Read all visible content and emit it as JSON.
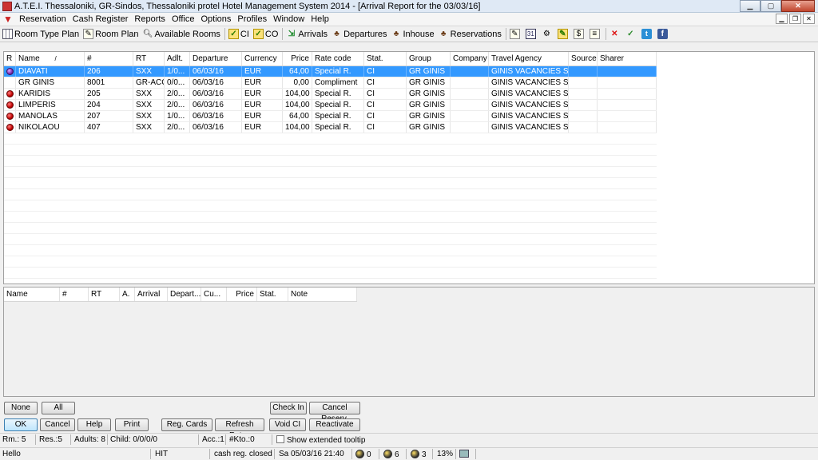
{
  "window": {
    "title": "A.T.E.I. Thessaloniki, GR-Sindos, Thessaloniki        protel Hotel Management System 2014 - [Arrival Report for the 03/03/16]"
  },
  "menu": [
    "Reservation",
    "Cash Register",
    "Reports",
    "Office",
    "Options",
    "Profiles",
    "Window",
    "Help"
  ],
  "toolbar": {
    "room_type_plan": "Room Type Plan",
    "room_plan": "Room Plan",
    "available_rooms": "Available Rooms",
    "ci": "CI",
    "co": "CO",
    "arrivals": "Arrivals",
    "departures": "Departures",
    "inhouse": "Inhouse",
    "reservations": "Reservations",
    "calendar_day": "31"
  },
  "top_grid": {
    "headers": [
      "R",
      "Name",
      "/",
      "#",
      "RT",
      "Adlt.",
      "Departure",
      "Currency",
      "Price",
      "Rate code",
      "Stat.",
      "Group",
      "Company",
      "Travel Agency",
      "Source",
      "Sharer"
    ],
    "rows": [
      {
        "status": "purple",
        "name": "DIAVATI",
        "num": "206",
        "rt": "SXX",
        "adlt": "1/0...",
        "departure": "06/03/16",
        "currency": "EUR",
        "price": "64,00",
        "rate_code": "Special R.",
        "stat": "CI",
        "group": "GR GINIS",
        "company": "",
        "agency": "GINIS VACANCIES SA",
        "source": "",
        "sharer": "",
        "selected": true
      },
      {
        "status": "none",
        "name": "GR GINIS",
        "num": "8001",
        "rt": "GR-ACC",
        "adlt": "0/0...",
        "departure": "06/03/16",
        "currency": "EUR",
        "price": "0,00",
        "rate_code": "Compliment",
        "stat": "CI",
        "group": "GR GINIS",
        "company": "",
        "agency": "GINIS VACANCIES SA",
        "source": "",
        "sharer": "",
        "selected": false
      },
      {
        "status": "red",
        "name": "KARIDIS",
        "num": "205",
        "rt": "SXX",
        "adlt": "2/0...",
        "departure": "06/03/16",
        "currency": "EUR",
        "price": "104,00",
        "rate_code": "Special R.",
        "stat": "CI",
        "group": "GR GINIS",
        "company": "",
        "agency": "GINIS VACANCIES SA",
        "source": "",
        "sharer": "",
        "selected": false
      },
      {
        "status": "red",
        "name": "LIMPERIS",
        "num": "204",
        "rt": "SXX",
        "adlt": "2/0...",
        "departure": "06/03/16",
        "currency": "EUR",
        "price": "104,00",
        "rate_code": "Special R.",
        "stat": "CI",
        "group": "GR GINIS",
        "company": "",
        "agency": "GINIS VACANCIES SA",
        "source": "",
        "sharer": "",
        "selected": false
      },
      {
        "status": "red",
        "name": "MANOLAS",
        "num": "207",
        "rt": "SXX",
        "adlt": "1/0...",
        "departure": "06/03/16",
        "currency": "EUR",
        "price": "64,00",
        "rate_code": "Special R.",
        "stat": "CI",
        "group": "GR GINIS",
        "company": "",
        "agency": "GINIS VACANCIES SA",
        "source": "",
        "sharer": "",
        "selected": false
      },
      {
        "status": "red",
        "name": "NIKOLAOU",
        "num": "407",
        "rt": "SXX",
        "adlt": "2/0...",
        "departure": "06/03/16",
        "currency": "EUR",
        "price": "104,00",
        "rate_code": "Special R.",
        "stat": "CI",
        "group": "GR GINIS",
        "company": "",
        "agency": "GINIS VACANCIES SA",
        "source": "",
        "sharer": "",
        "selected": false
      }
    ]
  },
  "bottom_grid": {
    "headers": [
      "Name",
      "#",
      "RT",
      "A.",
      "Arrival",
      "Depart...",
      "Cu...",
      "Price",
      "Stat.",
      "Note"
    ]
  },
  "buttons": {
    "none": "None",
    "all": "All",
    "check_in": "Check In",
    "cancel_reserv": "Cancel Reserv.",
    "ok": "OK",
    "cancel": "Cancel",
    "help": "Help",
    "print": "Print",
    "reg_cards": "Reg. Cards",
    "refresh_rates": "Refresh Rates",
    "void_ci": "Void CI",
    "reactivate": "Reactivate"
  },
  "status1": {
    "rm": "Rm.: 5",
    "res": "Res.:5",
    "adults": "Adults: 8",
    "child": "Child: 0/0/0/0",
    "acc": "Acc.:1",
    "kto": "#Kto.:0",
    "extended_tooltip": "Show extended tooltip"
  },
  "status2": {
    "hello": "Hello",
    "hit": "HIT",
    "cash": "cash reg. closed",
    "datetime": "Sa 05/03/16 21:40",
    "count_a": "0",
    "count_b": "6",
    "count_c": "3",
    "percent": "13%"
  }
}
